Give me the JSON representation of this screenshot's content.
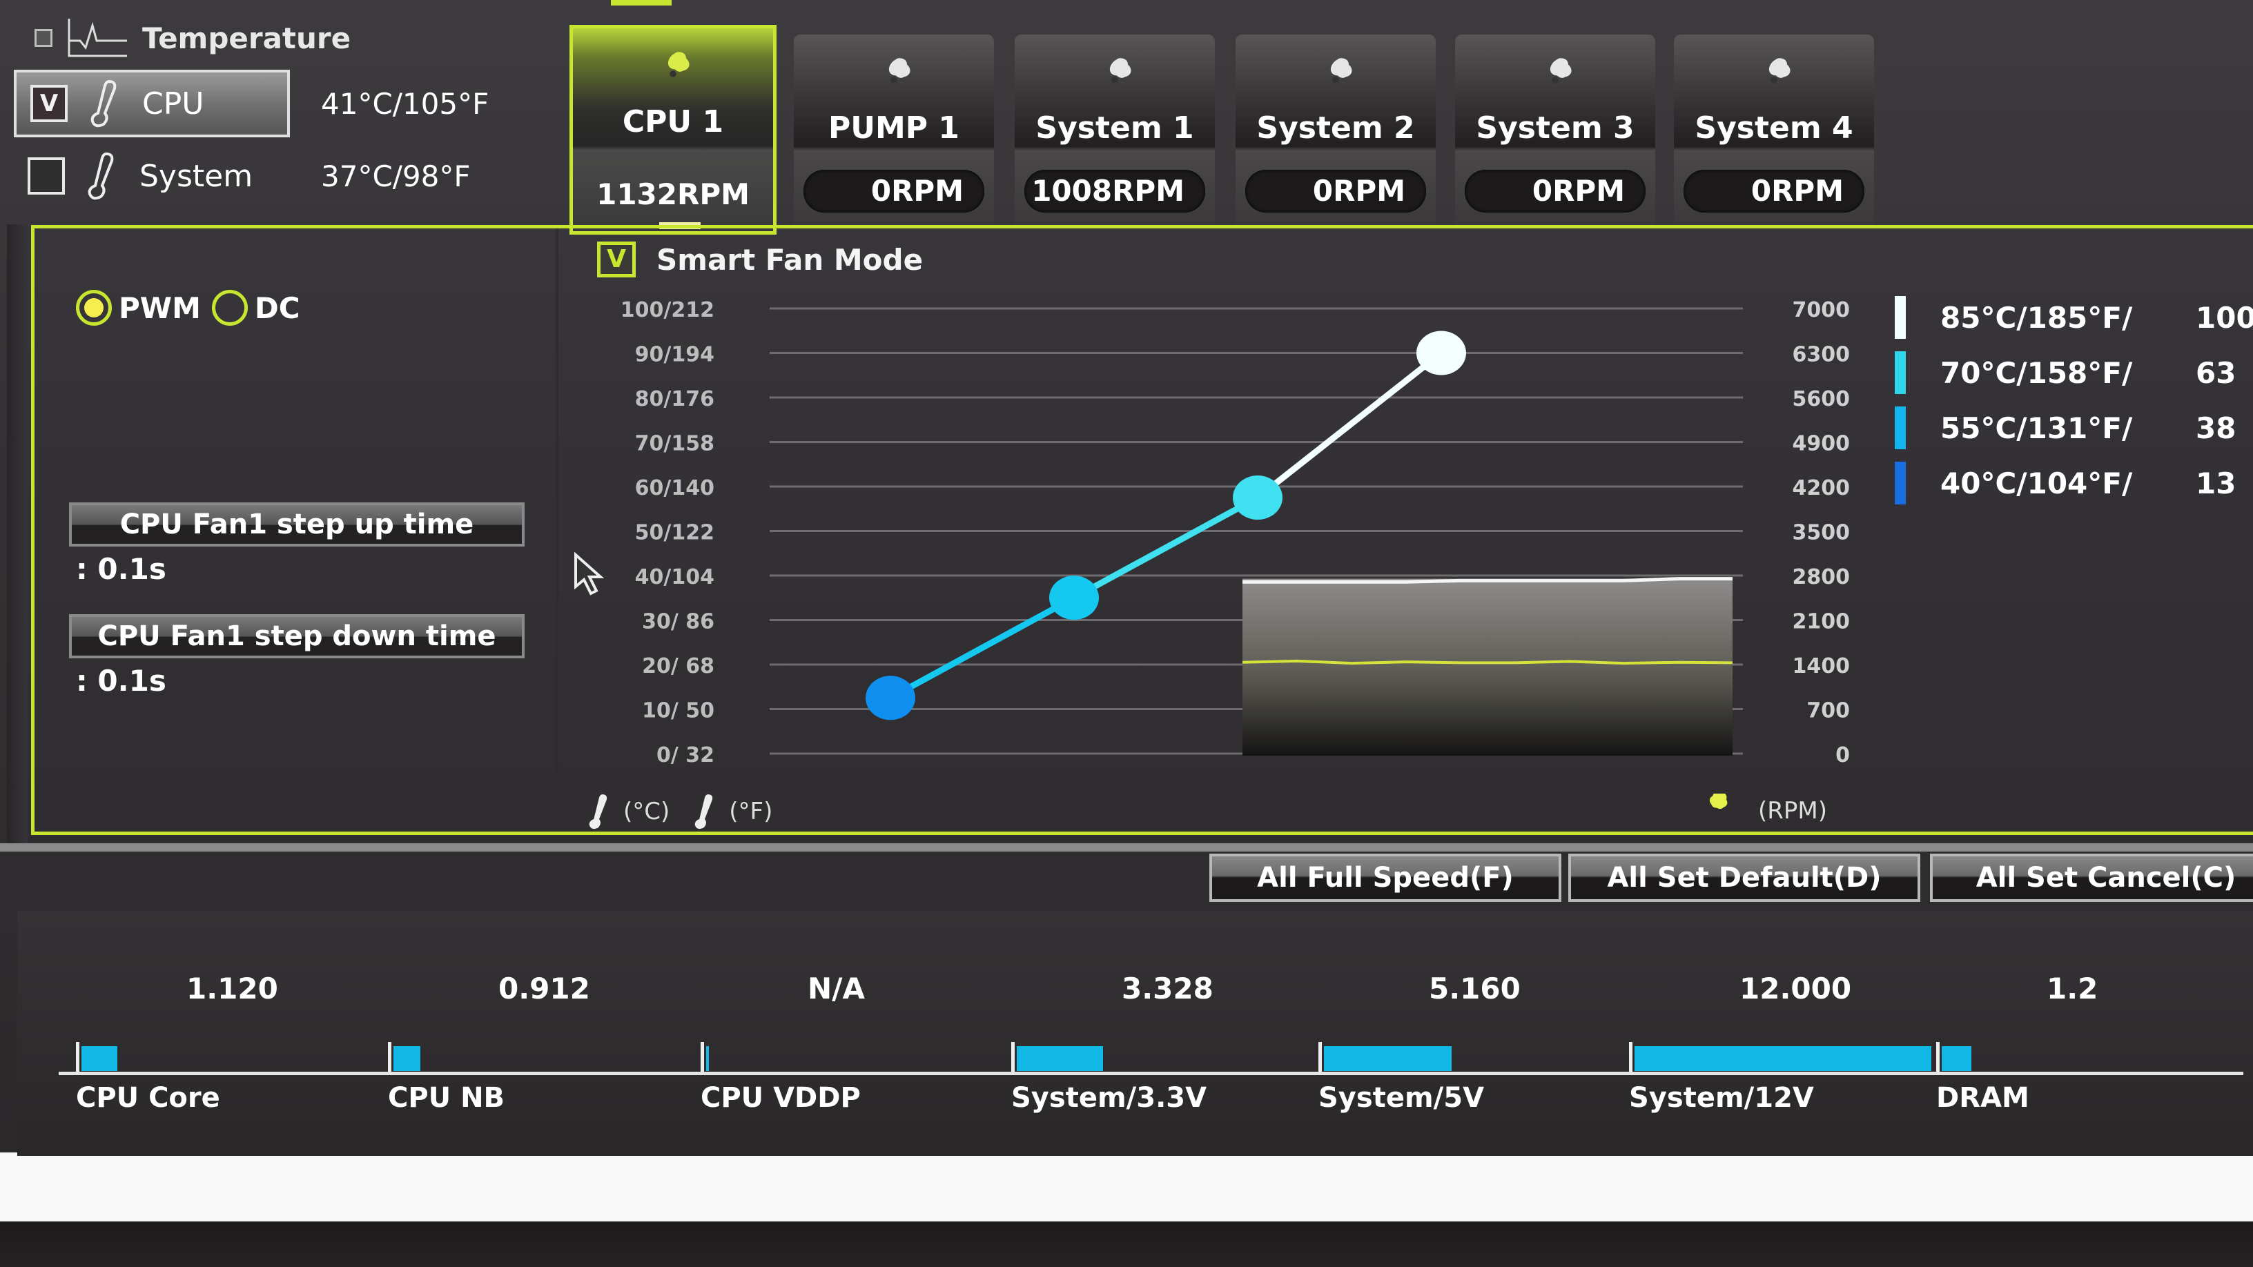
{
  "temperature": {
    "title": "Temperature",
    "sensors": [
      {
        "name": "CPU",
        "value": "41°C/105°F",
        "checked": true,
        "check_mark": "V"
      },
      {
        "name": "System",
        "value": "37°C/98°F",
        "checked": false,
        "check_mark": ""
      }
    ]
  },
  "fans": [
    {
      "name": "CPU 1",
      "rpm": "1132RPM",
      "active": true
    },
    {
      "name": "PUMP 1",
      "rpm": "0RPM",
      "active": false
    },
    {
      "name": "System 1",
      "rpm": "1008RPM",
      "active": false
    },
    {
      "name": "System 2",
      "rpm": "0RPM",
      "active": false
    },
    {
      "name": "System 3",
      "rpm": "0RPM",
      "active": false
    },
    {
      "name": "System 4",
      "rpm": "0RPM",
      "active": false
    }
  ],
  "fan_mode": {
    "options": [
      "PWM",
      "DC"
    ],
    "selected": "PWM"
  },
  "step_up": {
    "label": "CPU Fan1 step up time",
    "value": ": 0.1s"
  },
  "step_down": {
    "label": "CPU Fan1 step down time",
    "value": ": 0.1s"
  },
  "smart_fan": {
    "label": "Smart Fan Mode",
    "check_mark": "V",
    "checked": true
  },
  "units": {
    "celsius": "(°C)",
    "fahrenheit": "(°F)",
    "rpm": "(RPM)"
  },
  "chart_data": {
    "type": "line",
    "title": "Smart Fan Mode",
    "xlabel": "",
    "ylabel_left": "Temperature (°C / °F)",
    "ylabel_right": "(RPM)",
    "left_ticks": [
      "100/212",
      "90/194",
      "80/176",
      "70/158",
      "60/140",
      "50/122",
      "40/104",
      "30/ 86",
      "20/ 68",
      "10/ 50",
      "0/ 32"
    ],
    "right_ticks": [
      "7000",
      "6300",
      "5600",
      "4900",
      "4200",
      "3500",
      "2800",
      "2100",
      "1400",
      "700",
      "0"
    ],
    "ylim_temp_c": [
      0,
      100
    ],
    "ylim_rpm": [
      0,
      7000
    ],
    "grid": true,
    "curve_points": [
      {
        "temp_c": 40,
        "fan_pct": 13.9,
        "color": "#0f8ff0"
      },
      {
        "temp_c": 55,
        "fan_pct": 38.9,
        "color": "#14c8f0"
      },
      {
        "temp_c": 70,
        "fan_pct": 63.9,
        "color": "#40e0f0"
      },
      {
        "temp_c": 85,
        "fan_pct": 100,
        "color": "#f4ffff"
      }
    ],
    "monitor": {
      "rpm_history": [
        2700,
        2700,
        2700,
        2700,
        2720,
        2720,
        2720,
        2720,
        2750,
        2750
      ],
      "temp_history_c": [
        20.5,
        20.8,
        20.3,
        20.6,
        20.4,
        20.4,
        20.7,
        20.3,
        20.5,
        20.4
      ]
    },
    "legend": [
      {
        "temp": "85°C/185°F/",
        "pct": "100",
        "color": "#f4ffff"
      },
      {
        "temp": "70°C/158°F/",
        "pct": "63",
        "color": "#2fd6ee"
      },
      {
        "temp": "55°C/131°F/",
        "pct": "38",
        "color": "#14b6f0"
      },
      {
        "temp": "40°C/104°F/",
        "pct": "13",
        "color": "#1a6fe0"
      }
    ]
  },
  "actions": [
    {
      "label": "All Full Speed(F)"
    },
    {
      "label": "All Set Default(D)"
    },
    {
      "label": "All Set Cancel(C)"
    }
  ],
  "voltages": [
    {
      "label": "CPU Core",
      "value": "1.120",
      "fill": 0.12
    },
    {
      "label": "CPU NB",
      "value": "0.912",
      "fill": 0.09
    },
    {
      "label": "CPU VDDP",
      "value": "N/A",
      "fill": 0.01
    },
    {
      "label": "System/3.3V",
      "value": "3.328",
      "fill": 0.29
    },
    {
      "label": "System/5V",
      "value": "5.160",
      "fill": 0.43
    },
    {
      "label": "System/12V",
      "value": "12.000",
      "fill": 1.0
    },
    {
      "label": "DRAM",
      "value": "1.2",
      "fill": 0.1
    }
  ],
  "colors": {
    "accent": "#c8e630",
    "bar": "#12b9e6",
    "monitor_temp_line": "#d4e23a"
  }
}
